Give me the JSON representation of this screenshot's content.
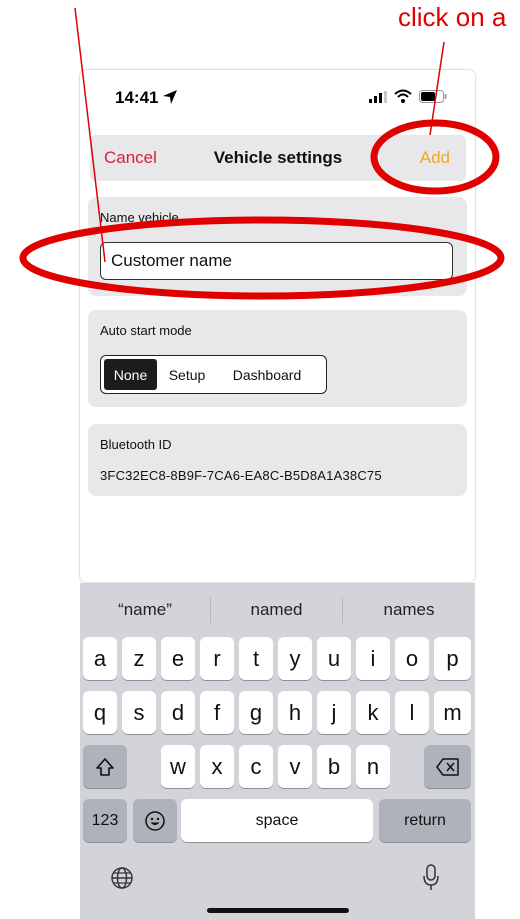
{
  "annotation": {
    "text": "click on a",
    "color": "#e00000"
  },
  "status_bar": {
    "time": "14:41",
    "icons": [
      "location-arrow-icon",
      "signal-icon",
      "wifi-icon",
      "battery-icon"
    ]
  },
  "nav": {
    "cancel_label": "Cancel",
    "title": "Vehicle settings",
    "add_label": "Add"
  },
  "name_section": {
    "label": "Name vehicle",
    "input_value": "Customer name"
  },
  "auto_start": {
    "label": "Auto start mode",
    "options": [
      "None",
      "Setup",
      "Dashboard"
    ],
    "selected": "None"
  },
  "bluetooth": {
    "label": "Bluetooth ID",
    "value": "3FC32EC8-8B9F-7CA6-EA8C-B5D8A1A38C75"
  },
  "keyboard": {
    "suggestions": [
      "“name”",
      "named",
      "names"
    ],
    "row1": [
      "a",
      "z",
      "e",
      "r",
      "t",
      "y",
      "u",
      "i",
      "o",
      "p"
    ],
    "row2": [
      "q",
      "s",
      "d",
      "f",
      "g",
      "h",
      "j",
      "k",
      "l",
      "m"
    ],
    "row3": [
      "w",
      "x",
      "c",
      "v",
      "b",
      "n"
    ],
    "numbers_label": "123",
    "space_label": "space",
    "return_label": "return"
  },
  "colors": {
    "cancel": "#d6213a",
    "add": "#f5a623",
    "accent_red": "#e00000"
  }
}
